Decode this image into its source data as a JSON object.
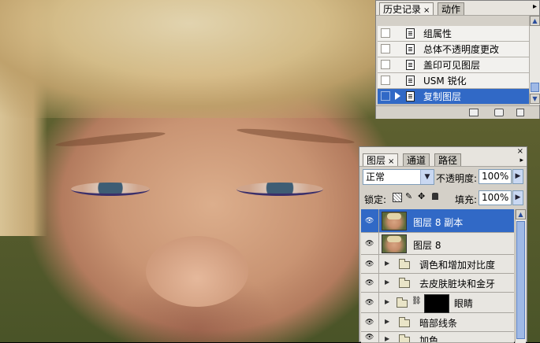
{
  "history_panel": {
    "tabs": [
      {
        "label": "历史记录",
        "close": "×"
      },
      {
        "label": "动作"
      }
    ],
    "menu_arrow": "▸",
    "items": [
      {
        "label": "组属性",
        "selected": false
      },
      {
        "label": "总体不透明度更改",
        "selected": false
      },
      {
        "label": "盖印可见图层",
        "selected": false
      },
      {
        "label": "USM 锐化",
        "selected": false
      },
      {
        "label": "复制图层",
        "selected": true
      }
    ]
  },
  "layers_panel": {
    "tabs": [
      {
        "label": "图层",
        "close": "×"
      },
      {
        "label": "通道"
      },
      {
        "label": "路径"
      }
    ],
    "blend_mode": "正常",
    "opacity_label": "不透明度:",
    "opacity_value": "100%",
    "lock_label": "锁定:",
    "fill_label": "填充:",
    "fill_value": "100%",
    "layers": [
      {
        "label": "图层 8 副本",
        "type": "image",
        "selected": true
      },
      {
        "label": "图层 8",
        "type": "image",
        "selected": false
      },
      {
        "label": "调色和增加对比度",
        "type": "group",
        "selected": false
      },
      {
        "label": "去皮肤脏块和金牙",
        "type": "group",
        "selected": false
      },
      {
        "label": "眼睛",
        "type": "group-mask",
        "selected": false
      },
      {
        "label": "暗部线条",
        "type": "group",
        "selected": false
      },
      {
        "label": "加色",
        "type": "group",
        "selected": false
      }
    ]
  },
  "icons": {
    "visibility": "eye-icon",
    "dropdown": "chevron-down-icon",
    "spin": "arrow-right-icon"
  },
  "colors": {
    "selection": "#3169c6",
    "panel": "#d4d0c8"
  }
}
